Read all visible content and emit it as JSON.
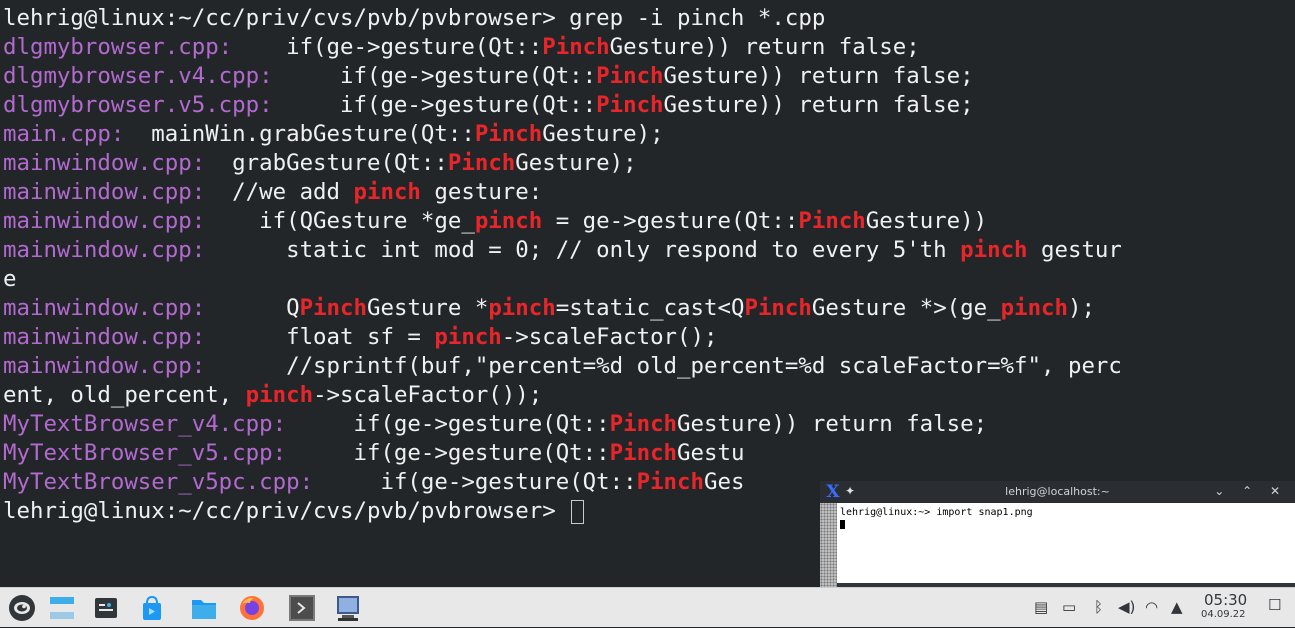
{
  "terminal": {
    "lines": [
      [
        {
          "t": "lehrig@linux:~/cc/priv/cvs/pvb/pvbrowser> grep -i pinch *.cpp",
          "c": "txt"
        }
      ],
      [
        {
          "t": "dlgmybrowser.cpp:",
          "c": "fn"
        },
        {
          "t": "    if(ge->gesture(Qt::",
          "c": "txt"
        },
        {
          "t": "Pinch",
          "c": "hl"
        },
        {
          "t": "Gesture)) return false;",
          "c": "txt"
        }
      ],
      [
        {
          "t": "dlgmybrowser.v4.cpp:",
          "c": "fn"
        },
        {
          "t": "     if(ge->gesture(Qt::",
          "c": "txt"
        },
        {
          "t": "Pinch",
          "c": "hl"
        },
        {
          "t": "Gesture)) return false;",
          "c": "txt"
        }
      ],
      [
        {
          "t": "dlgmybrowser.v5.cpp:",
          "c": "fn"
        },
        {
          "t": "     if(ge->gesture(Qt::",
          "c": "txt"
        },
        {
          "t": "Pinch",
          "c": "hl"
        },
        {
          "t": "Gesture)) return false;",
          "c": "txt"
        }
      ],
      [
        {
          "t": "main.cpp:",
          "c": "fn"
        },
        {
          "t": "  mainWin.grabGesture(Qt::",
          "c": "txt"
        },
        {
          "t": "Pinch",
          "c": "hl"
        },
        {
          "t": "Gesture);",
          "c": "txt"
        }
      ],
      [
        {
          "t": "mainwindow.cpp:",
          "c": "fn"
        },
        {
          "t": "  grabGesture(Qt::",
          "c": "txt"
        },
        {
          "t": "Pinch",
          "c": "hl"
        },
        {
          "t": "Gesture);",
          "c": "txt"
        }
      ],
      [
        {
          "t": "mainwindow.cpp:",
          "c": "fn"
        },
        {
          "t": "  //we add ",
          "c": "txt"
        },
        {
          "t": "pinch",
          "c": "hl"
        },
        {
          "t": " gesture:",
          "c": "txt"
        }
      ],
      [
        {
          "t": "mainwindow.cpp:",
          "c": "fn"
        },
        {
          "t": "    if(QGesture *ge_",
          "c": "txt"
        },
        {
          "t": "pinch",
          "c": "hl"
        },
        {
          "t": " = ge->gesture(Qt::",
          "c": "txt"
        },
        {
          "t": "Pinch",
          "c": "hl"
        },
        {
          "t": "Gesture))",
          "c": "txt"
        }
      ],
      [
        {
          "t": "mainwindow.cpp:",
          "c": "fn"
        },
        {
          "t": "      static int mod = 0; // only respond to every 5'th ",
          "c": "txt"
        },
        {
          "t": "pinch",
          "c": "hl"
        },
        {
          "t": " gestur",
          "c": "txt"
        }
      ],
      [
        {
          "t": "e",
          "c": "txt"
        }
      ],
      [
        {
          "t": "mainwindow.cpp:",
          "c": "fn"
        },
        {
          "t": "      Q",
          "c": "txt"
        },
        {
          "t": "Pinch",
          "c": "hl"
        },
        {
          "t": "Gesture *",
          "c": "txt"
        },
        {
          "t": "pinch",
          "c": "hl"
        },
        {
          "t": "=static_cast<Q",
          "c": "txt"
        },
        {
          "t": "Pinch",
          "c": "hl"
        },
        {
          "t": "Gesture *>(ge_",
          "c": "txt"
        },
        {
          "t": "pinch",
          "c": "hl"
        },
        {
          "t": ");",
          "c": "txt"
        }
      ],
      [
        {
          "t": "mainwindow.cpp:",
          "c": "fn"
        },
        {
          "t": "      float sf = ",
          "c": "txt"
        },
        {
          "t": "pinch",
          "c": "hl"
        },
        {
          "t": "->scaleFactor();",
          "c": "txt"
        }
      ],
      [
        {
          "t": "mainwindow.cpp:",
          "c": "fn"
        },
        {
          "t": "      //sprintf(buf,\"percent=%d old_percent=%d scaleFactor=%f\", perc",
          "c": "txt"
        }
      ],
      [
        {
          "t": "ent, old_percent, ",
          "c": "txt"
        },
        {
          "t": "pinch",
          "c": "hl"
        },
        {
          "t": "->scaleFactor());",
          "c": "txt"
        }
      ],
      [
        {
          "t": "MyTextBrowser_v4.cpp:",
          "c": "fn"
        },
        {
          "t": "     if(ge->gesture(Qt::",
          "c": "txt"
        },
        {
          "t": "Pinch",
          "c": "hl"
        },
        {
          "t": "Gesture)) return false;",
          "c": "txt"
        }
      ],
      [
        {
          "t": "MyTextBrowser_v5.cpp:",
          "c": "fn"
        },
        {
          "t": "     if(ge->gesture(Qt::",
          "c": "txt"
        },
        {
          "t": "Pinch",
          "c": "hl"
        },
        {
          "t": "Gestu",
          "c": "txt"
        }
      ],
      [
        {
          "t": "MyTextBrowser_v5pc.cpp:",
          "c": "fn"
        },
        {
          "t": "     if(ge->gesture(Qt::",
          "c": "txt"
        },
        {
          "t": "Pinch",
          "c": "hl"
        },
        {
          "t": "Ges",
          "c": "txt"
        }
      ],
      [
        {
          "t": "lehrig@linux:~/cc/priv/cvs/pvb/pvbrowser> ",
          "c": "txt"
        }
      ]
    ],
    "colors": {
      "text": "#eff0f1",
      "filename": "#b36ad0",
      "match": "#e8262a",
      "background": "#232629"
    }
  },
  "xterm": {
    "title": "lehrig@localhost:~",
    "logo": "X",
    "pin": "✦",
    "buttons": "⌄ ⌃ ✕",
    "command_line": "lehrig@linux:~> import snap1.png"
  },
  "taskbar": {
    "apps": [
      "opensuse-menu-icon",
      "desktop-pager-icon",
      "system-settings-icon",
      "software-store-icon",
      "file-manager-icon",
      "firefox-icon",
      "konsole-icon",
      "terminal-window-icon"
    ],
    "tray": {
      "icons": [
        "clipboard-icon",
        "battery-icon",
        "bluetooth-icon",
        "volume-icon",
        "wifi-icon",
        "expand-tray-icon"
      ],
      "time": "05:30",
      "date": "04.09.22"
    }
  }
}
